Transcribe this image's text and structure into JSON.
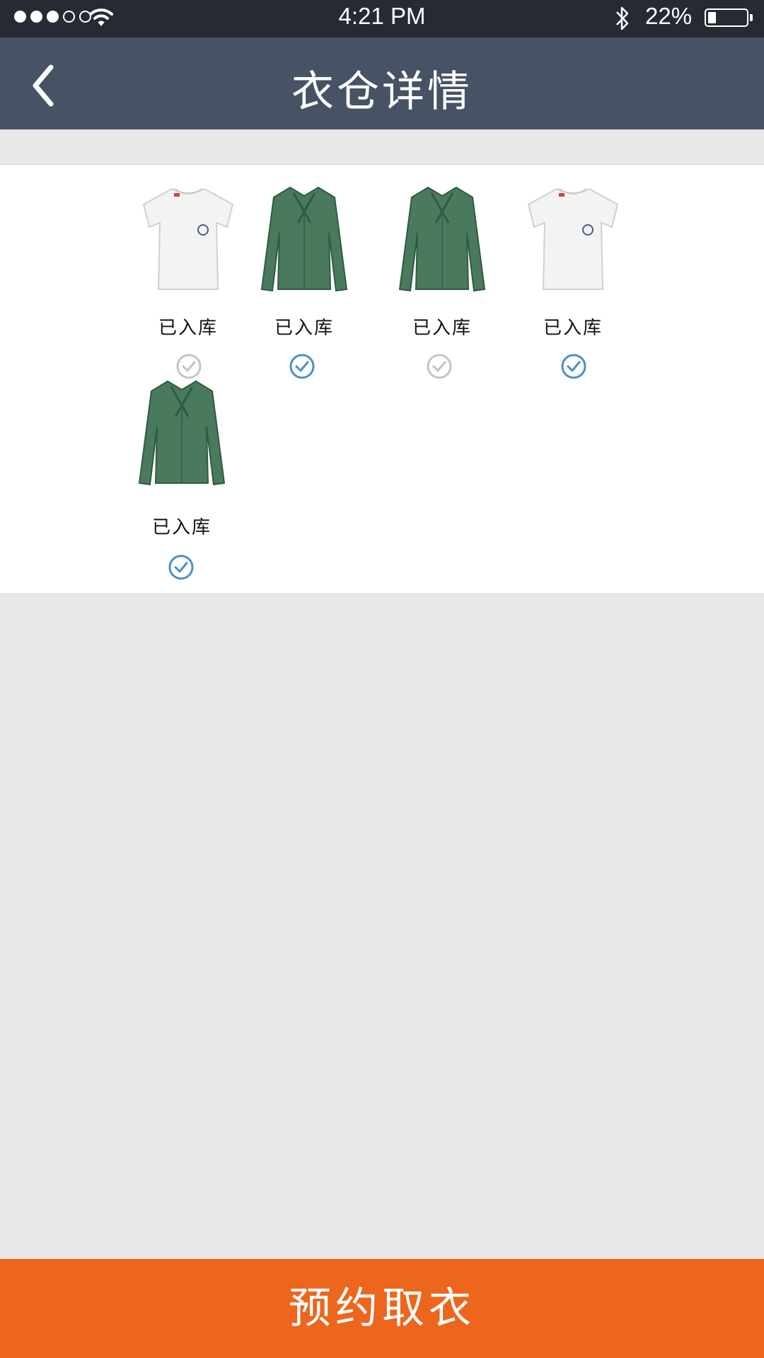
{
  "status_bar": {
    "time": "4:21 PM",
    "battery_percent": "22%",
    "battery_level": 0.22,
    "signal_bars_filled": 3,
    "signal_bars_total": 5
  },
  "header": {
    "title": "衣仓详情",
    "back_icon": "chevron-left-icon"
  },
  "items": [
    {
      "image": "white-tshirt",
      "status": "已入库",
      "checked": false
    },
    {
      "image": "green-blouse",
      "status": "已入库",
      "checked": true
    },
    {
      "image": "green-blouse",
      "status": "已入库",
      "checked": false
    },
    {
      "image": "white-tshirt",
      "status": "已入库",
      "checked": true
    },
    {
      "image": "green-blouse",
      "status": "已入库",
      "checked": true
    }
  ],
  "footer": {
    "button_label": "预约取衣"
  },
  "colors": {
    "nav_background": "#475265",
    "status_bar_background": "#262b33",
    "accent_orange": "#ec661e",
    "check_active": "#4a90c8",
    "check_inactive": "#c4c4c4",
    "page_background": "#e8e8e8"
  }
}
